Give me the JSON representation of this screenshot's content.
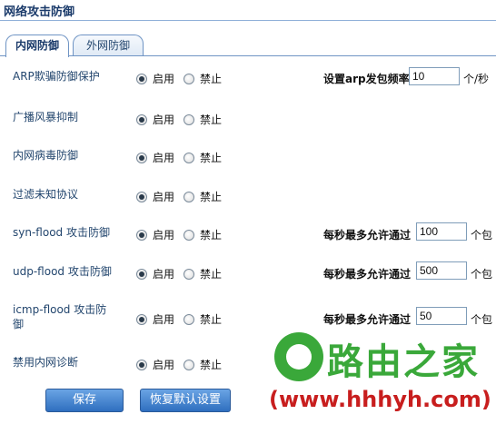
{
  "page": {
    "title": "网络攻击防御"
  },
  "tabs": [
    {
      "label": "内网防御",
      "active": true
    },
    {
      "label": "外网防御",
      "active": false
    }
  ],
  "radio_labels": {
    "enable": "启用",
    "disable": "禁止"
  },
  "rows": [
    {
      "label": "ARP欺骗防御保护",
      "enabled": true,
      "param_label": "设置arp发包频率",
      "param_value": "10",
      "param_unit": "个/秒"
    },
    {
      "label": "广播风暴抑制",
      "enabled": true
    },
    {
      "label": "内网病毒防御",
      "enabled": true
    },
    {
      "label": "过滤未知协议",
      "enabled": true
    },
    {
      "label": "syn-flood 攻击防御",
      "enabled": true,
      "param_label": "每秒最多允许通过",
      "param_value": "100",
      "param_unit": "个包"
    },
    {
      "label": "udp-flood 攻击防御",
      "enabled": true,
      "param_label": "每秒最多允许通过",
      "param_value": "500",
      "param_unit": "个包"
    },
    {
      "label_line1": "icmp-flood 攻击防",
      "label_line2": "御",
      "enabled": true,
      "param_label": "每秒最多允许通过",
      "param_value": "50",
      "param_unit": "个包"
    },
    {
      "label": "禁用内网诊断",
      "enabled": true
    }
  ],
  "buttons": {
    "save": "保存",
    "reset": "恢复默认设置"
  },
  "watermark": {
    "brand": "路由之家",
    "url": "(www.hhhyh.com)",
    "color_brand": "#3aa83a",
    "color_url": "#c81e1e"
  }
}
